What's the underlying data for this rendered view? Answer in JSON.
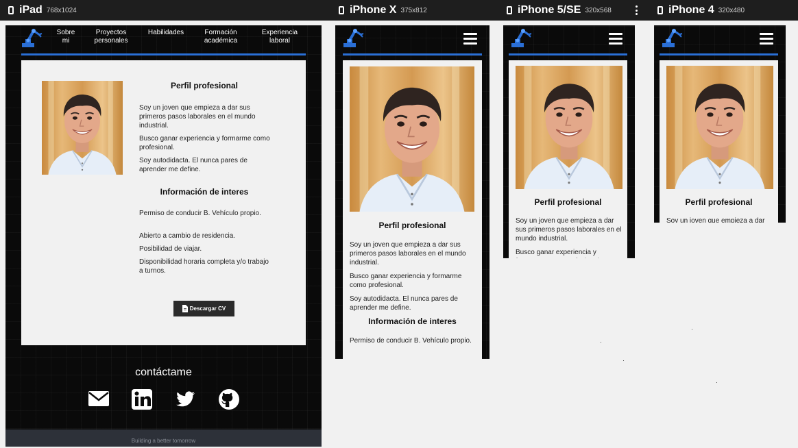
{
  "devices": [
    {
      "name": "iPad",
      "size": "768x1024"
    },
    {
      "name": "iPhone X",
      "size": "375x812"
    },
    {
      "name": "iPhone 5/SE",
      "size": "320x568"
    },
    {
      "name": "iPhone 4",
      "size": "320x480"
    }
  ],
  "nav": {
    "links": [
      {
        "line1": "Sobre",
        "line2": "mi"
      },
      {
        "line1": "Proyectos",
        "line2": "personales"
      },
      {
        "line1": "Habilidades",
        "line2": ""
      },
      {
        "line1": "Formación",
        "line2": "académica"
      },
      {
        "line1": "Experiencia",
        "line2": "laboral"
      }
    ]
  },
  "profile": {
    "title": "Perfil profesional",
    "paragraphs": [
      "Soy un joven que empieza a dar sus primeros pasos laborales en el mundo industrial.",
      "Busco ganar experiencia y formarme como profesional.",
      "Soy autodidacta. El nunca pares de aprender me define."
    ]
  },
  "interests": {
    "title": "Información de interes",
    "items": [
      "Permiso de conducir B. Vehículo propio.",
      "Abierto a cambio de residencia.",
      "Posibilidad de viajar.",
      "Disponibilidad horaria completa y/o trabajo a turnos."
    ]
  },
  "cv_button": "Descargar CV",
  "contact": {
    "title": "contáctame",
    "icons": [
      "email-icon",
      "linkedin-icon",
      "twitter-icon",
      "github-icon"
    ]
  },
  "footer": "Building a better tomorrow",
  "colors": {
    "accent": "#2a6fd6",
    "frame_bg": "#0a0a0a",
    "card_bg": "#f1f1f1",
    "button_bg": "#2b2b2b",
    "footer_bg": "#2d3139"
  }
}
